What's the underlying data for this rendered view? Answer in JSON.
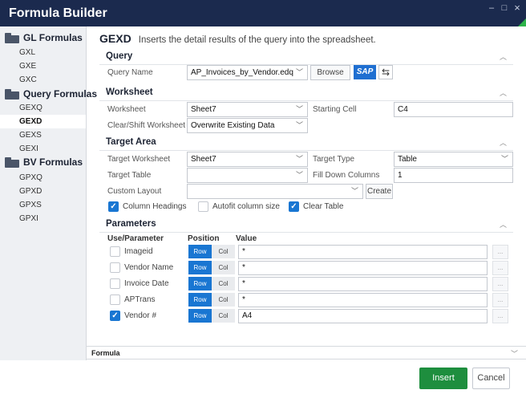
{
  "window": {
    "title": "Formula Builder",
    "minimize_glyph": "–",
    "maximize_glyph": "□",
    "close_glyph": "×"
  },
  "sidebar": {
    "groups": [
      {
        "label": "GL Formulas",
        "items": [
          "GXL",
          "GXE",
          "GXC"
        ]
      },
      {
        "label": "Query Formulas",
        "items": [
          "GEXQ",
          "GEXD",
          "GEXS",
          "GEXI"
        ]
      },
      {
        "label": "BV Formulas",
        "items": [
          "GPXQ",
          "GPXD",
          "GPXS",
          "GPXI"
        ]
      }
    ],
    "active_item": "GEXD"
  },
  "heading": {
    "code": "GEXD",
    "description": "Inserts the detail results of the query into the spreadsheet."
  },
  "query": {
    "section_title": "Query",
    "name_label": "Query Name",
    "name_value": "AP_Invoices_by_Vendor.edq",
    "browse_label": "Browse",
    "sap_label": "SAP"
  },
  "worksheet": {
    "section_title": "Worksheet",
    "worksheet_label": "Worksheet",
    "worksheet_value": "Sheet7",
    "starting_cell_label": "Starting Cell",
    "starting_cell_value": "C4",
    "clear_shift_label": "Clear/Shift Worksheet",
    "clear_shift_value": "Overwrite Existing Data"
  },
  "target_area": {
    "section_title": "Target Area",
    "target_worksheet_label": "Target Worksheet",
    "target_worksheet_value": "Sheet7",
    "target_type_label": "Target Type",
    "target_type_value": "Table",
    "target_table_label": "Target Table",
    "target_table_value": "",
    "fill_down_label": "Fill Down Columns",
    "fill_down_value": "1",
    "custom_layout_label": "Custom Layout",
    "custom_layout_value": "",
    "create_label": "Create",
    "column_headings_label": "Column Headings",
    "column_headings_checked": true,
    "autofit_label": "Autofit column size",
    "autofit_checked": false,
    "clear_table_label": "Clear Table",
    "clear_table_checked": true
  },
  "parameters": {
    "section_title": "Parameters",
    "col_use": "Use/Parameter",
    "col_position": "Position",
    "col_value": "Value",
    "row_label": "Row",
    "col_label": "Col",
    "ellipsis": "...",
    "rows": [
      {
        "name": "Imageid",
        "checked": false,
        "value": "*"
      },
      {
        "name": "Vendor Name",
        "checked": false,
        "value": "*"
      },
      {
        "name": "Invoice Date",
        "checked": false,
        "value": "*"
      },
      {
        "name": "APTrans",
        "checked": false,
        "value": "*"
      },
      {
        "name": "Vendor #",
        "checked": true,
        "value": "A4"
      }
    ]
  },
  "formula": {
    "label": "Formula"
  },
  "footer": {
    "insert_label": "Insert",
    "cancel_label": "Cancel"
  },
  "colors": {
    "titlebar": "#1b2a4e",
    "accent_blue": "#1976d2",
    "insert_green": "#1e8e3e",
    "sap_blue": "#1f6fd1"
  }
}
